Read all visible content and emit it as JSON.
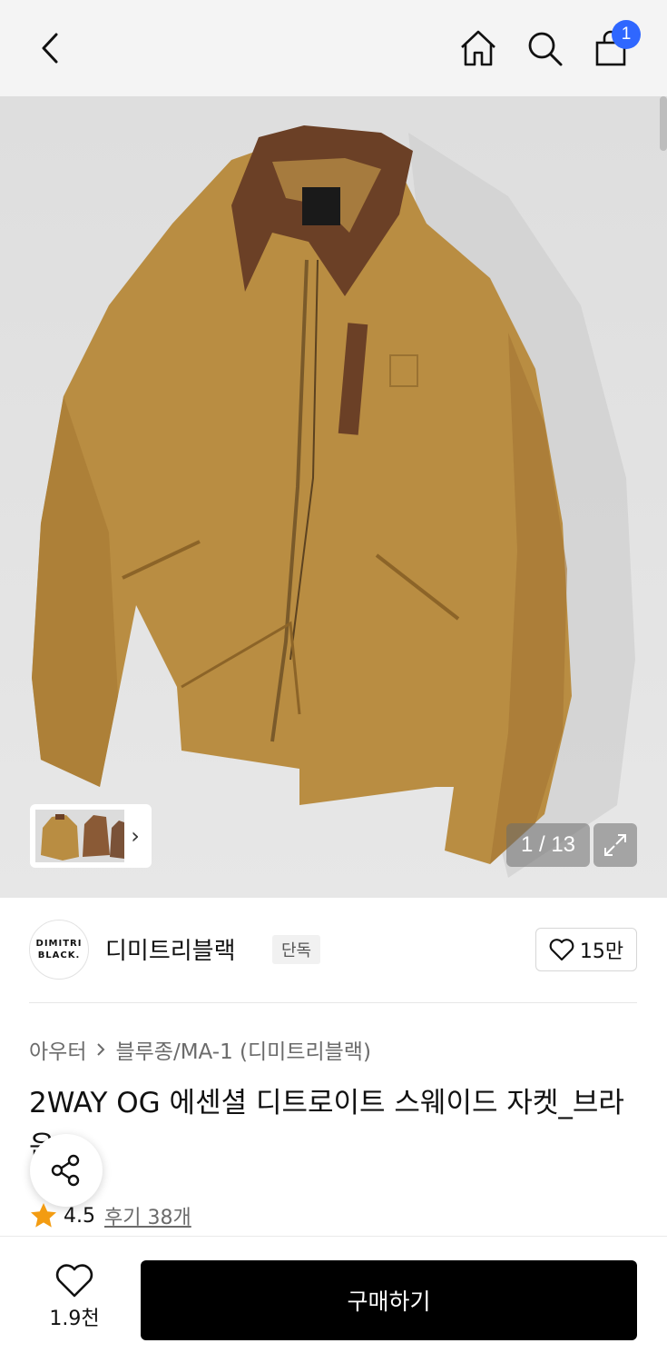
{
  "header": {
    "back_icon": "chevron-left-icon",
    "home_icon": "home-icon",
    "search_icon": "search-icon",
    "cart_icon": "bag-icon",
    "cart_badge": "1",
    "badge_color": "#2f67ff"
  },
  "gallery": {
    "counter": "1 / 13",
    "thumbnail_more_icon": "chevron-right-icon",
    "expand_icon": "expand-icon"
  },
  "brand": {
    "logo_line1": "DIMITRI",
    "logo_line2": "BLACK.",
    "name": "디미트리블랙",
    "tag": "단독",
    "like_count": "15만"
  },
  "product": {
    "breadcrumb": [
      "아우터",
      "블루종/MA-1 (디미트리블랙)"
    ],
    "title": "2WAY OG 에센셜 디트로이트 스웨이드 자켓_브라운",
    "rating": "4.5",
    "reviews": "후기 38개",
    "star_color": "#f39c12"
  },
  "footer": {
    "wish_count": "1.9천",
    "buy_label": "구매하기"
  }
}
